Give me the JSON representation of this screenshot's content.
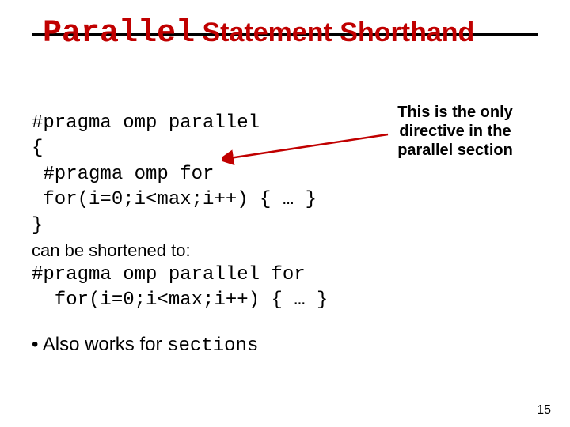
{
  "title": {
    "part1_mono": "Parallel",
    "part2": " Statement Shorthand"
  },
  "code1": {
    "l1": "#pragma omp parallel",
    "l2": "{",
    "l3": " #pragma omp for",
    "l4": " for(i=0;i<max;i++) { … }",
    "l5": "}"
  },
  "shorten_label": "can be shortened to:",
  "code2": {
    "l1": "#pragma omp parallel for",
    "l2": "  for(i=0;i<max;i++) { … }"
  },
  "callout": "This is the only directive in the parallel section",
  "bullet": {
    "prefix": "• Also works for ",
    "mono": "sections"
  },
  "page_number": "15"
}
